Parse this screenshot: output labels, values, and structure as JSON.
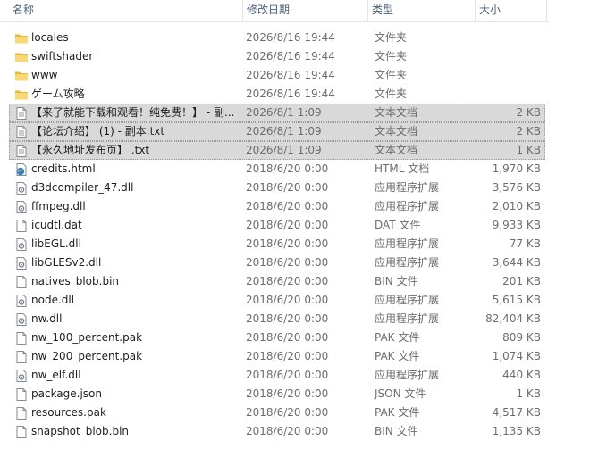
{
  "columns": {
    "name": "名称",
    "date": "修改日期",
    "type": "类型",
    "size": "大小"
  },
  "files": [
    {
      "icon": "folder-icon",
      "name": "locales",
      "date": "2026/8/16 19:44",
      "type": "文件夹",
      "size": "",
      "selected": false
    },
    {
      "icon": "folder-icon",
      "name": "swiftshader",
      "date": "2026/8/16 19:44",
      "type": "文件夹",
      "size": "",
      "selected": false
    },
    {
      "icon": "folder-icon",
      "name": "www",
      "date": "2026/8/16 19:44",
      "type": "文件夹",
      "size": "",
      "selected": false
    },
    {
      "icon": "folder-icon",
      "name": "ゲーム攻略",
      "date": "2026/8/16 19:44",
      "type": "文件夹",
      "size": "",
      "selected": false
    },
    {
      "icon": "text-file-icon",
      "name": "【来了就能下载和观看！纯免费！】 - 副...",
      "date": "2026/8/1 1:09",
      "type": "文本文档",
      "size": "2 KB",
      "selected": true
    },
    {
      "icon": "text-file-icon",
      "name": "【论坛介绍】 (1) - 副本.txt",
      "date": "2026/8/1 1:09",
      "type": "文本文档",
      "size": "2 KB",
      "selected": true
    },
    {
      "icon": "text-file-icon",
      "name": "【永久地址发布页】 .txt",
      "date": "2026/8/1 1:09",
      "type": "文本文档",
      "size": "1 KB",
      "selected": true
    },
    {
      "icon": "html-file-icon",
      "name": "credits.html",
      "date": "2018/6/20 0:00",
      "type": "HTML 文档",
      "size": "1,970 KB",
      "selected": false
    },
    {
      "icon": "dll-file-icon",
      "name": "d3dcompiler_47.dll",
      "date": "2018/6/20 0:00",
      "type": "应用程序扩展",
      "size": "3,576 KB",
      "selected": false
    },
    {
      "icon": "dll-file-icon",
      "name": "ffmpeg.dll",
      "date": "2018/6/20 0:00",
      "type": "应用程序扩展",
      "size": "2,010 KB",
      "selected": false
    },
    {
      "icon": "blank-file-icon",
      "name": "icudtl.dat",
      "date": "2018/6/20 0:00",
      "type": "DAT 文件",
      "size": "9,933 KB",
      "selected": false
    },
    {
      "icon": "dll-file-icon",
      "name": "libEGL.dll",
      "date": "2018/6/20 0:00",
      "type": "应用程序扩展",
      "size": "77 KB",
      "selected": false
    },
    {
      "icon": "dll-file-icon",
      "name": "libGLESv2.dll",
      "date": "2018/6/20 0:00",
      "type": "应用程序扩展",
      "size": "3,644 KB",
      "selected": false
    },
    {
      "icon": "blank-file-icon",
      "name": "natives_blob.bin",
      "date": "2018/6/20 0:00",
      "type": "BIN 文件",
      "size": "201 KB",
      "selected": false
    },
    {
      "icon": "dll-file-icon",
      "name": "node.dll",
      "date": "2018/6/20 0:00",
      "type": "应用程序扩展",
      "size": "5,615 KB",
      "selected": false
    },
    {
      "icon": "dll-file-icon",
      "name": "nw.dll",
      "date": "2018/6/20 0:00",
      "type": "应用程序扩展",
      "size": "82,404 KB",
      "selected": false
    },
    {
      "icon": "blank-file-icon",
      "name": "nw_100_percent.pak",
      "date": "2018/6/20 0:00",
      "type": "PAK 文件",
      "size": "809 KB",
      "selected": false
    },
    {
      "icon": "blank-file-icon",
      "name": "nw_200_percent.pak",
      "date": "2018/6/20 0:00",
      "type": "PAK 文件",
      "size": "1,074 KB",
      "selected": false
    },
    {
      "icon": "dll-file-icon",
      "name": "nw_elf.dll",
      "date": "2018/6/20 0:00",
      "type": "应用程序扩展",
      "size": "440 KB",
      "selected": false
    },
    {
      "icon": "blank-file-icon",
      "name": "package.json",
      "date": "2018/6/20 0:00",
      "type": "JSON 文件",
      "size": "1 KB",
      "selected": false
    },
    {
      "icon": "blank-file-icon",
      "name": "resources.pak",
      "date": "2018/6/20 0:00",
      "type": "PAK 文件",
      "size": "4,517 KB",
      "selected": false
    },
    {
      "icon": "blank-file-icon",
      "name": "snapshot_blob.bin",
      "date": "2018/6/20 0:00",
      "type": "BIN 文件",
      "size": "1,135 KB",
      "selected": false
    }
  ]
}
